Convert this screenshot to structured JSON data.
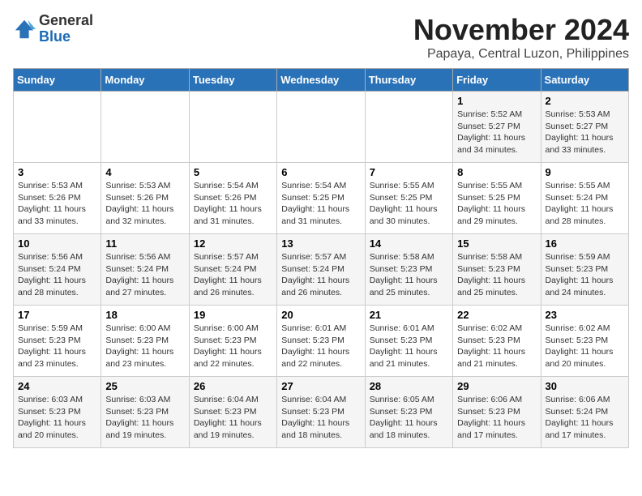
{
  "header": {
    "logo_general": "General",
    "logo_blue": "Blue",
    "month_year": "November 2024",
    "location": "Papaya, Central Luzon, Philippines"
  },
  "weekdays": [
    "Sunday",
    "Monday",
    "Tuesday",
    "Wednesday",
    "Thursday",
    "Friday",
    "Saturday"
  ],
  "weeks": [
    [
      {
        "day": "",
        "details": ""
      },
      {
        "day": "",
        "details": ""
      },
      {
        "day": "",
        "details": ""
      },
      {
        "day": "",
        "details": ""
      },
      {
        "day": "",
        "details": ""
      },
      {
        "day": "1",
        "details": "Sunrise: 5:52 AM\nSunset: 5:27 PM\nDaylight: 11 hours\nand 34 minutes."
      },
      {
        "day": "2",
        "details": "Sunrise: 5:53 AM\nSunset: 5:27 PM\nDaylight: 11 hours\nand 33 minutes."
      }
    ],
    [
      {
        "day": "3",
        "details": "Sunrise: 5:53 AM\nSunset: 5:26 PM\nDaylight: 11 hours\nand 33 minutes."
      },
      {
        "day": "4",
        "details": "Sunrise: 5:53 AM\nSunset: 5:26 PM\nDaylight: 11 hours\nand 32 minutes."
      },
      {
        "day": "5",
        "details": "Sunrise: 5:54 AM\nSunset: 5:26 PM\nDaylight: 11 hours\nand 31 minutes."
      },
      {
        "day": "6",
        "details": "Sunrise: 5:54 AM\nSunset: 5:25 PM\nDaylight: 11 hours\nand 31 minutes."
      },
      {
        "day": "7",
        "details": "Sunrise: 5:55 AM\nSunset: 5:25 PM\nDaylight: 11 hours\nand 30 minutes."
      },
      {
        "day": "8",
        "details": "Sunrise: 5:55 AM\nSunset: 5:25 PM\nDaylight: 11 hours\nand 29 minutes."
      },
      {
        "day": "9",
        "details": "Sunrise: 5:55 AM\nSunset: 5:24 PM\nDaylight: 11 hours\nand 28 minutes."
      }
    ],
    [
      {
        "day": "10",
        "details": "Sunrise: 5:56 AM\nSunset: 5:24 PM\nDaylight: 11 hours\nand 28 minutes."
      },
      {
        "day": "11",
        "details": "Sunrise: 5:56 AM\nSunset: 5:24 PM\nDaylight: 11 hours\nand 27 minutes."
      },
      {
        "day": "12",
        "details": "Sunrise: 5:57 AM\nSunset: 5:24 PM\nDaylight: 11 hours\nand 26 minutes."
      },
      {
        "day": "13",
        "details": "Sunrise: 5:57 AM\nSunset: 5:24 PM\nDaylight: 11 hours\nand 26 minutes."
      },
      {
        "day": "14",
        "details": "Sunrise: 5:58 AM\nSunset: 5:23 PM\nDaylight: 11 hours\nand 25 minutes."
      },
      {
        "day": "15",
        "details": "Sunrise: 5:58 AM\nSunset: 5:23 PM\nDaylight: 11 hours\nand 25 minutes."
      },
      {
        "day": "16",
        "details": "Sunrise: 5:59 AM\nSunset: 5:23 PM\nDaylight: 11 hours\nand 24 minutes."
      }
    ],
    [
      {
        "day": "17",
        "details": "Sunrise: 5:59 AM\nSunset: 5:23 PM\nDaylight: 11 hours\nand 23 minutes."
      },
      {
        "day": "18",
        "details": "Sunrise: 6:00 AM\nSunset: 5:23 PM\nDaylight: 11 hours\nand 23 minutes."
      },
      {
        "day": "19",
        "details": "Sunrise: 6:00 AM\nSunset: 5:23 PM\nDaylight: 11 hours\nand 22 minutes."
      },
      {
        "day": "20",
        "details": "Sunrise: 6:01 AM\nSunset: 5:23 PM\nDaylight: 11 hours\nand 22 minutes."
      },
      {
        "day": "21",
        "details": "Sunrise: 6:01 AM\nSunset: 5:23 PM\nDaylight: 11 hours\nand 21 minutes."
      },
      {
        "day": "22",
        "details": "Sunrise: 6:02 AM\nSunset: 5:23 PM\nDaylight: 11 hours\nand 21 minutes."
      },
      {
        "day": "23",
        "details": "Sunrise: 6:02 AM\nSunset: 5:23 PM\nDaylight: 11 hours\nand 20 minutes."
      }
    ],
    [
      {
        "day": "24",
        "details": "Sunrise: 6:03 AM\nSunset: 5:23 PM\nDaylight: 11 hours\nand 20 minutes."
      },
      {
        "day": "25",
        "details": "Sunrise: 6:03 AM\nSunset: 5:23 PM\nDaylight: 11 hours\nand 19 minutes."
      },
      {
        "day": "26",
        "details": "Sunrise: 6:04 AM\nSunset: 5:23 PM\nDaylight: 11 hours\nand 19 minutes."
      },
      {
        "day": "27",
        "details": "Sunrise: 6:04 AM\nSunset: 5:23 PM\nDaylight: 11 hours\nand 18 minutes."
      },
      {
        "day": "28",
        "details": "Sunrise: 6:05 AM\nSunset: 5:23 PM\nDaylight: 11 hours\nand 18 minutes."
      },
      {
        "day": "29",
        "details": "Sunrise: 6:06 AM\nSunset: 5:23 PM\nDaylight: 11 hours\nand 17 minutes."
      },
      {
        "day": "30",
        "details": "Sunrise: 6:06 AM\nSunset: 5:24 PM\nDaylight: 11 hours\nand 17 minutes."
      }
    ]
  ]
}
